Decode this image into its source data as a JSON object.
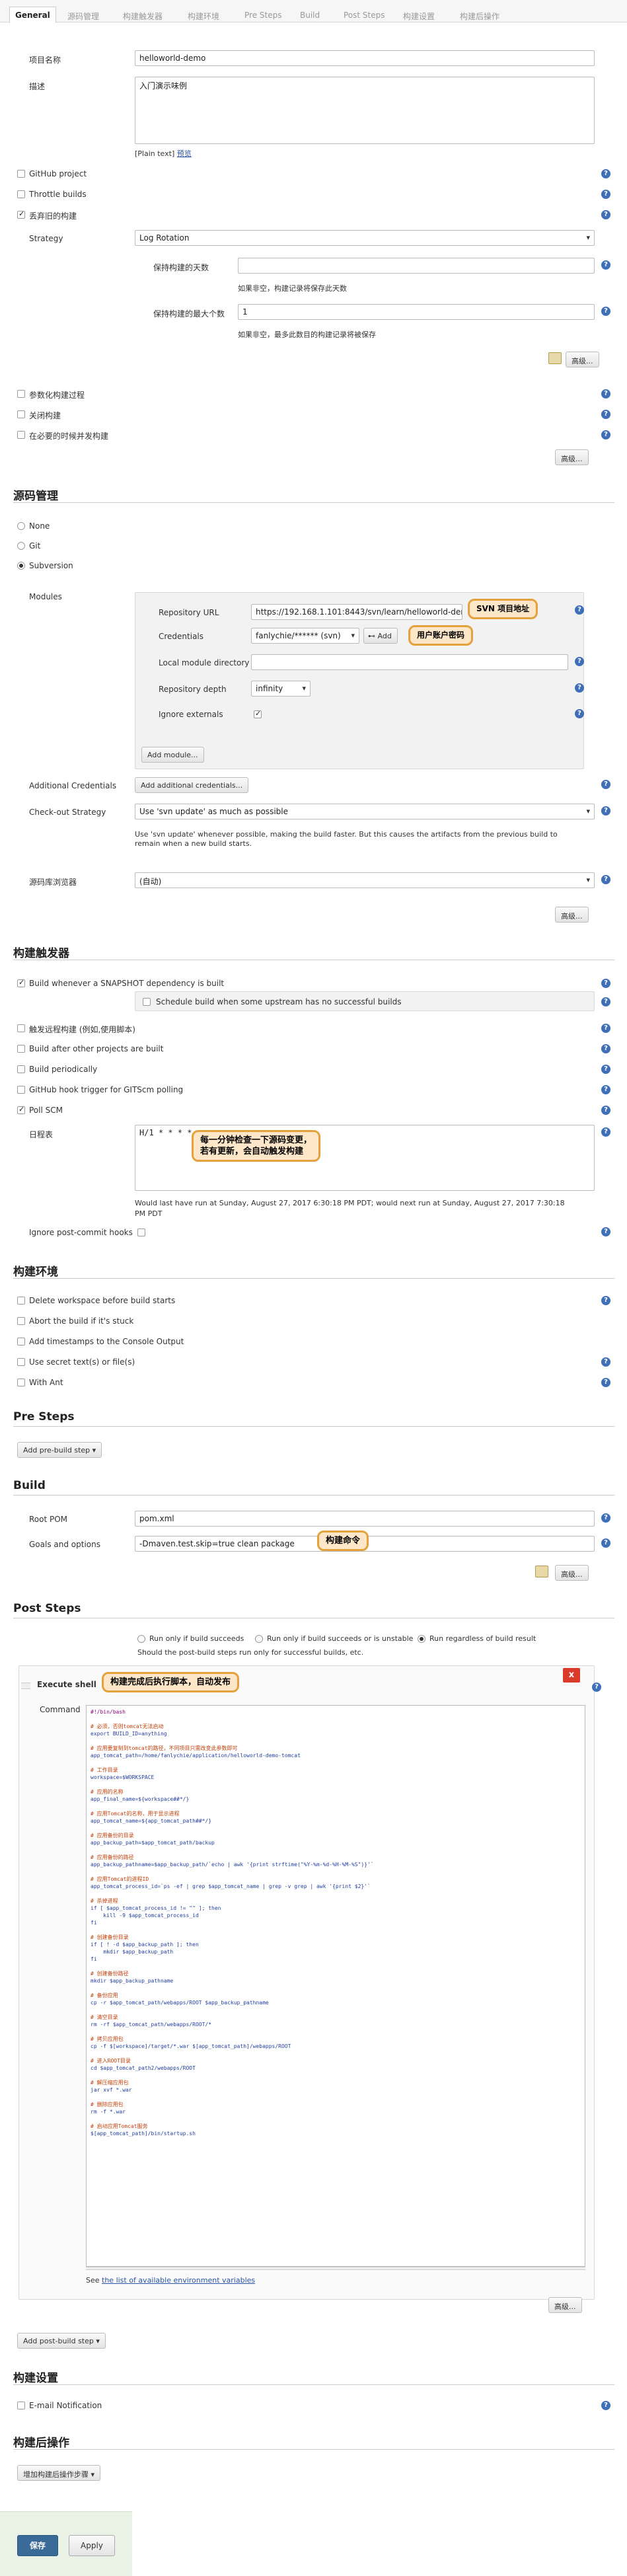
{
  "tabs": [
    "General",
    "源码管理",
    "构建触发器",
    "构建环境",
    "Pre Steps",
    "Build",
    "Post Steps",
    "构建设置",
    "构建后操作"
  ],
  "general": {
    "project_name_label": "项目名称",
    "project_name": "helloworld-demo",
    "desc_label": "描述",
    "desc": "入门演示味例",
    "plain_text": "[Plain text]",
    "preview": "预览",
    "github_project": "GitHub project",
    "throttle": "Throttle builds",
    "discard": "丢弃旧的构建",
    "strategy_label": "Strategy",
    "strategy": "Log Rotation",
    "days_label": "保持构建的天数",
    "days_hint": "如果非空，构建记录将保存此天数",
    "max_label": "保持构建的最大个数",
    "max_value": "1",
    "max_hint": "如果非空，最多此数目的构建记录将被保存",
    "advanced": "高级...",
    "param": "参数化构建过程",
    "disable": "关闭构建",
    "concurrent": "在必要的时候并发构建"
  },
  "scm": {
    "title": "源码管理",
    "none": "None",
    "git": "Git",
    "svn": "Subversion",
    "modules": "Modules",
    "repo_url_label": "Repository URL",
    "repo_url": "https://192.168.1.101:8443/svn/learn/helloworld-demo",
    "cred_label": "Credentials",
    "cred": "fanlychie/****** (svn)",
    "add_cred": "Add",
    "local_label": "Local module directory",
    "depth_label": "Repository depth",
    "depth": "infinity",
    "ignore_label": "Ignore externals",
    "add_module": "Add module...",
    "addl_label": "Additional Credentials",
    "addl_btn": "Add additional credentials...",
    "checkout_label": "Check-out Strategy",
    "checkout": "Use 'svn update' as much as possible",
    "checkout_hint1": "Use 'svn update' whenever possible, making the build faster. But this causes the artifacts from the previous build to",
    "checkout_hint2": "remain when a new build starts.",
    "browser_label": "源码库浏览器",
    "browser": "(自动)",
    "callout_url": "SVN 项目地址",
    "callout_cred": "用户账户密码"
  },
  "triggers": {
    "title": "构建触发器",
    "snapshot": "Build whenever a SNAPSHOT dependency is built",
    "schedule": "Schedule build when some upstream has no successful builds",
    "remote": "触发远程构建 (例如,使用脚本)",
    "after": "Build after other projects are built",
    "periodic": "Build periodically",
    "github": "GitHub hook trigger for GITScm polling",
    "poll": "Poll SCM",
    "schedule_label": "日程表",
    "schedule_value": "H/1 * * * *",
    "callout1": "每一分钟检查一下源码变更，",
    "callout2": "若有更新，会自动触发构建",
    "last_run1": "Would last have run at Sunday, August 27, 2017 6:30:18 PM PDT; would next run at Sunday, August 27, 2017 7:30:18",
    "last_run2": "PM PDT",
    "ignore_hooks": "Ignore post-commit hooks"
  },
  "env": {
    "title": "构建环境",
    "delete": "Delete workspace before build starts",
    "abort": "Abort the build if it's stuck",
    "timestamps": "Add timestamps to the Console Output",
    "secret": "Use secret text(s) or file(s)",
    "ant": "With Ant"
  },
  "pre": {
    "title": "Pre Steps",
    "add": "Add pre-build step"
  },
  "build": {
    "title": "Build",
    "pom_label": "Root POM",
    "pom": "pom.xml",
    "goals_label": "Goals and options",
    "goals": "-Dmaven.test.skip=true clean package",
    "callout": "构建命令"
  },
  "post": {
    "title": "Post Steps",
    "r1": "Run only if build succeeds",
    "r2": "Run only if build succeeds or is unstable",
    "r3": "Run regardless of build result",
    "hint": "Should the post-build steps run only for successful builds, etc.",
    "shell": "Execute shell",
    "callout": "构建完成后执行脚本，自动发布",
    "command": "Command",
    "see1": "See ",
    "see_link": "the list of available environment variables",
    "add": "Add post-build step"
  },
  "settings": {
    "title": "构建设置",
    "email": "E-mail Notification"
  },
  "postbuild": {
    "title": "构建后操作",
    "add": "增加构建后操作步骤"
  },
  "actions": {
    "save": "保存",
    "apply": "Apply"
  },
  "script": [
    [
      "k",
      "#!/bin/bash"
    ],
    [
      "b",
      ""
    ],
    [
      "c",
      "# 必须，否则tomcat无法启动"
    ],
    [
      "v",
      "export BUILD_ID=anything"
    ],
    [
      "b",
      ""
    ],
    [
      "c",
      "# 应用要复制到tomcat的路径，不同项目只需改变此参数即可"
    ],
    [
      "v",
      "app_tomcat_path=/home/fanlychie/application/helloworld-demo-tomcat"
    ],
    [
      "b",
      ""
    ],
    [
      "c",
      "# 工作目录"
    ],
    [
      "v",
      "workspace=$WORKSPACE"
    ],
    [
      "b",
      ""
    ],
    [
      "c",
      "# 应用的名称"
    ],
    [
      "v",
      "app_final_name=${workspace##*/}"
    ],
    [
      "b",
      ""
    ],
    [
      "c",
      "# 应用Tomcat的名称，用于显示进程"
    ],
    [
      "v",
      "app_tomcat_name=${app_tomcat_path##*/}"
    ],
    [
      "b",
      ""
    ],
    [
      "c",
      "# 应用备份的目录"
    ],
    [
      "v",
      "app_backup_path=$app_tomcat_path/backup"
    ],
    [
      "b",
      ""
    ],
    [
      "c",
      "# 应用备份的路径"
    ],
    [
      "v",
      "app_backup_pathname=$app_backup_path/`echo | awk '{print strftime(\"%Y-%m-%d-%H-%M-%S\")}'`"
    ],
    [
      "b",
      ""
    ],
    [
      "c",
      "# 应用Tomcat的进程ID"
    ],
    [
      "v",
      "app_tomcat_process_id=`ps -ef | grep $app_tomcat_name | grep -v grep | awk '{print $2}'`"
    ],
    [
      "b",
      ""
    ],
    [
      "c",
      "# 杀掉进程"
    ],
    [
      "v",
      "if [ $app_tomcat_process_id != \"\" ]; then"
    ],
    [
      "v",
      "    kill -9 $app_tomcat_process_id"
    ],
    [
      "v",
      "fi"
    ],
    [
      "b",
      ""
    ],
    [
      "c",
      "# 创建备份目录"
    ],
    [
      "v",
      "if [ ! -d $app_backup_path ]; then"
    ],
    [
      "v",
      "    mkdir $app_backup_path"
    ],
    [
      "v",
      "fi"
    ],
    [
      "b",
      ""
    ],
    [
      "c",
      "# 创建备份路径"
    ],
    [
      "v",
      "mkdir $app_backup_pathname"
    ],
    [
      "b",
      ""
    ],
    [
      "c",
      "# 备份应用"
    ],
    [
      "v",
      "cp -r $app_tomcat_path/webapps/ROOT $app_backup_pathname"
    ],
    [
      "b",
      ""
    ],
    [
      "c",
      "# 清空目录"
    ],
    [
      "v",
      "rm -rf $app_tomcat_path/webapps/ROOT/*"
    ],
    [
      "b",
      ""
    ],
    [
      "c",
      "# 拷贝应用包"
    ],
    [
      "v",
      "cp -f $[workspace]/target/*.war $[app_tomcat_path]/webapps/ROOT"
    ],
    [
      "b",
      ""
    ],
    [
      "c",
      "# 进入ROOT目录"
    ],
    [
      "v",
      "cd $app_tomcat_path2/webapps/ROOT"
    ],
    [
      "b",
      ""
    ],
    [
      "c",
      "# 解压缩应用包"
    ],
    [
      "v",
      "jar xvf *.war"
    ],
    [
      "b",
      ""
    ],
    [
      "c",
      "# 删除应用包"
    ],
    [
      "v",
      "rm -f *.war"
    ],
    [
      "b",
      ""
    ],
    [
      "c",
      "# 启动应用Tomcat服务"
    ],
    [
      "v",
      "$[app_tomcat_path]/bin/startup.sh"
    ]
  ]
}
